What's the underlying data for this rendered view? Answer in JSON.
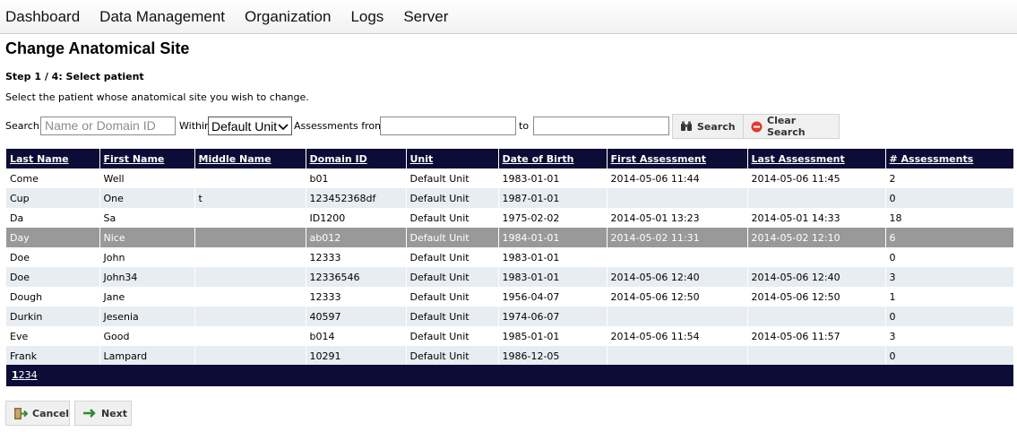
{
  "nav": {
    "items": [
      "Dashboard",
      "Data Management",
      "Organization",
      "Logs",
      "Server"
    ]
  },
  "page": {
    "title": "Change Anatomical Site",
    "step": "Step 1 / 4: Select patient",
    "instructions": "Select the patient whose anatomical site you wish to change."
  },
  "search": {
    "label": "Search:",
    "placeholder": "Name or Domain ID",
    "within_label": "Within",
    "unit_value": "Default Unit",
    "assessments_from_label": "Assessments from",
    "to_label": "to",
    "search_button": "Search",
    "clear_button": "Clear Search"
  },
  "table": {
    "columns": [
      "Last Name",
      "First Name",
      "Middle Name",
      "Domain ID",
      "Unit",
      "Date of Birth",
      "First Assessment",
      "Last Assessment",
      "# Assessments"
    ],
    "rows": [
      [
        "Come",
        "Well",
        "",
        "b01",
        "Default Unit",
        "1983-01-01",
        "2014-05-06 11:44",
        "2014-05-06 11:45",
        "2"
      ],
      [
        "Cup",
        "One",
        "t",
        "123452368df",
        "Default Unit",
        "1987-01-01",
        "",
        "",
        "0"
      ],
      [
        "Da",
        "Sa",
        "",
        "ID1200",
        "Default Unit",
        "1975-02-02",
        "2014-05-01 13:23",
        "2014-05-01 14:33",
        "18"
      ],
      [
        "Day",
        "Nice",
        "",
        "ab012",
        "Default Unit",
        "1984-01-01",
        "2014-05-02 11:31",
        "2014-05-02 12:10",
        "6"
      ],
      [
        "Doe",
        "John",
        "",
        "12333",
        "Default Unit",
        "1983-01-01",
        "",
        "",
        "0"
      ],
      [
        "Doe",
        "John34",
        "",
        "12336546",
        "Default Unit",
        "1983-01-01",
        "2014-05-06 12:40",
        "2014-05-06 12:40",
        "3"
      ],
      [
        "Dough",
        "Jane",
        "",
        "12333",
        "Default Unit",
        "1956-04-07",
        "2014-05-06 12:50",
        "2014-05-06 12:50",
        "1"
      ],
      [
        "Durkin",
        "Jesenia",
        "",
        "40597",
        "Default Unit",
        "1974-06-07",
        "",
        "",
        "0"
      ],
      [
        "Eve",
        "Good",
        "",
        "b014",
        "Default Unit",
        "1985-01-01",
        "2014-05-06 11:54",
        "2014-05-06 11:57",
        "3"
      ],
      [
        "Frank",
        "Lampard",
        "",
        "10291",
        "Default Unit",
        "1986-12-05",
        "",
        "",
        "0"
      ]
    ],
    "selected_row": 3
  },
  "pager": {
    "pages": [
      "1",
      "2",
      "3",
      "4"
    ],
    "current": "1"
  },
  "footer": {
    "cancel": "Cancel",
    "next": "Next"
  },
  "colors": {
    "header_bg": "#0c0c36",
    "row_alt": "#e8edf2",
    "row_selected": "#999999"
  }
}
